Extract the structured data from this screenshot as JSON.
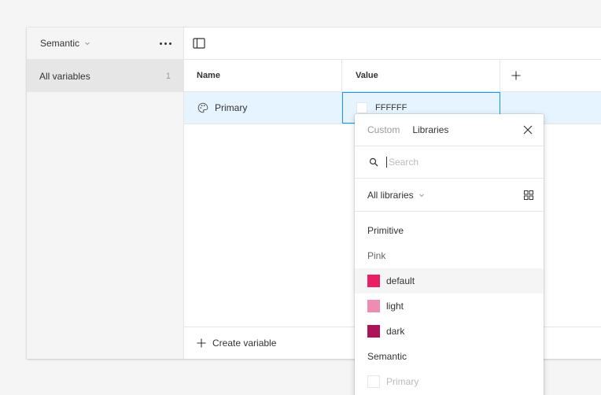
{
  "sidebar": {
    "collection_name": "Semantic",
    "items": [
      {
        "label": "All variables",
        "count": "1"
      }
    ]
  },
  "table": {
    "headers": {
      "name": "Name",
      "value": "Value"
    },
    "rows": [
      {
        "name": "Primary",
        "value": "FFFFFF"
      }
    ]
  },
  "footer": {
    "create_label": "Create variable"
  },
  "popover": {
    "tabs": [
      "Custom",
      "Libraries"
    ],
    "active_tab": "Libraries",
    "search_placeholder": "Search",
    "filter_label": "All libraries",
    "groups": [
      {
        "heading": "Primitive",
        "subheading": "Pink",
        "items": [
          {
            "label": "default",
            "color": "#e91e63"
          },
          {
            "label": "light",
            "color": "#f08cb1"
          },
          {
            "label": "dark",
            "color": "#ad1457"
          }
        ]
      },
      {
        "heading": "Semantic",
        "items": [
          {
            "label": "Primary",
            "color": "#ffffff",
            "disabled": true
          }
        ]
      }
    ]
  },
  "colors": {
    "selection_bg": "#e5f4ff",
    "selection_border": "#0d99ff",
    "sidebar_bg": "#f5f5f5"
  }
}
